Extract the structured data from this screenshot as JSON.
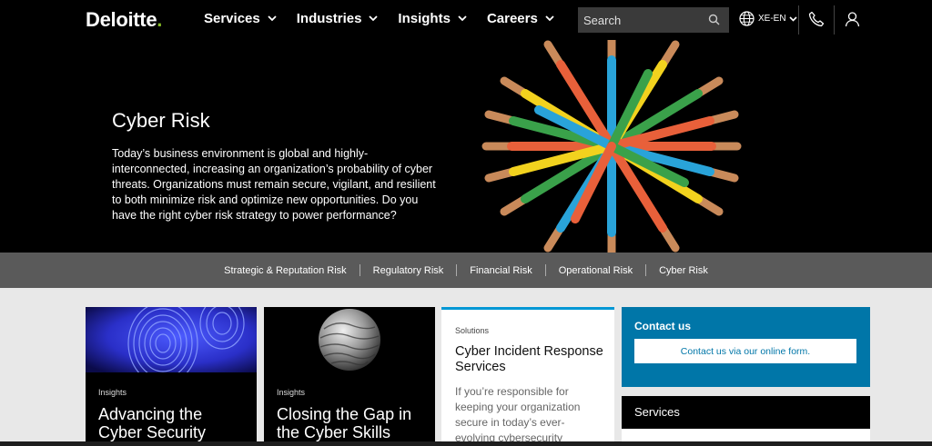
{
  "header": {
    "logo": "Deloitte",
    "logo_dot": ".",
    "nav": [
      {
        "label": "Services"
      },
      {
        "label": "Industries"
      },
      {
        "label": "Insights"
      },
      {
        "label": "Careers"
      }
    ],
    "search_placeholder": "Search",
    "locale": "XE-EN"
  },
  "hero": {
    "title": "Cyber Risk",
    "description": "Today’s business environment is global and highly-interconnected, increasing an organization’s probability of cyber threats. Organizations must remain secure, vigilant, and resilient to both minimize risk and optimize new opportunities. Do you have the right cyber risk strategy to power performance?"
  },
  "subnav": [
    "Strategic & Reputation Risk",
    "Regulatory Risk",
    "Financial Risk",
    "Operational Risk",
    "Cyber Risk"
  ],
  "cards": [
    {
      "tag": "Insights",
      "title": "Advancing the Cyber Security"
    },
    {
      "tag": "Insights",
      "title": "Closing the Gap in the Cyber Skills"
    }
  ],
  "solution": {
    "tag": "Solutions",
    "title": "Cyber Incident Response Services",
    "text": "If you’re responsible for keeping your organization secure in today’s ever-evolving cybersecurity"
  },
  "contact": {
    "title": "Contact us",
    "button": "Contact us via our online form."
  },
  "services": {
    "label": "Services"
  },
  "colors": {
    "brand_green": "#86bc25",
    "accent_blue": "#0076a8",
    "highlight_blue": "#0097d4"
  }
}
